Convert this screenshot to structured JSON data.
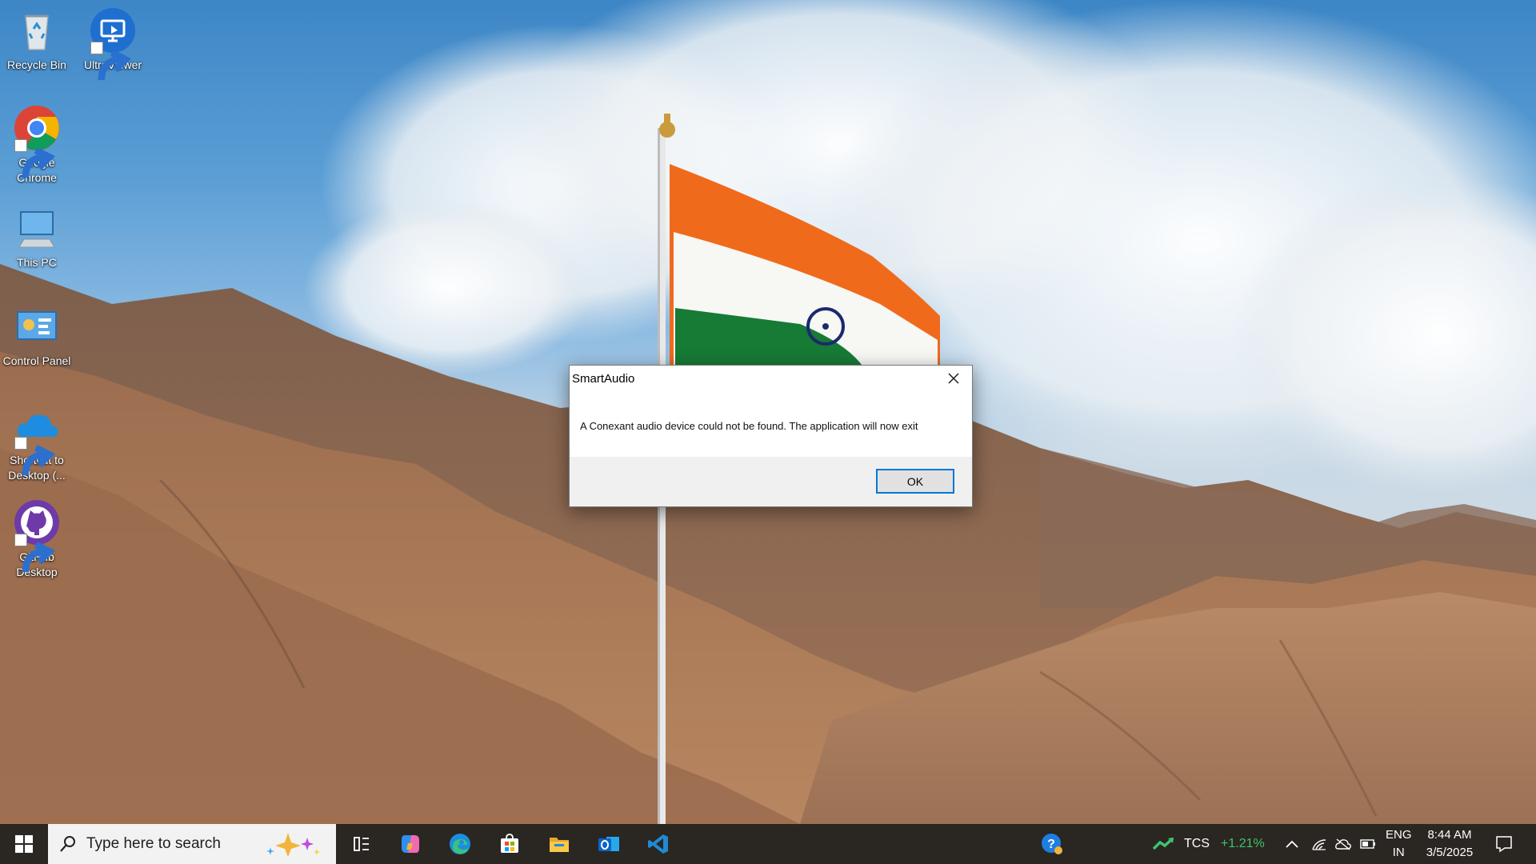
{
  "desktop": {
    "icons": [
      {
        "label": "Recycle Bin",
        "icon": "recycle-bin-icon"
      },
      {
        "label": "UltraViewer",
        "icon": "ultraviewer-icon"
      },
      {
        "label": "Google Chrome",
        "icon": "chrome-icon"
      },
      {
        "label": "This PC",
        "icon": "this-pc-icon"
      },
      {
        "label": "Control Panel",
        "icon": "control-panel-icon"
      },
      {
        "label": "Shortcut to Desktop (...",
        "icon": "onedrive-icon"
      },
      {
        "label": "GitHub Desktop",
        "icon": "github-icon"
      }
    ]
  },
  "dialog": {
    "title": "SmartAudio",
    "message": "A Conexant audio device could not be found. The application will now exit",
    "ok_label": "OK"
  },
  "taskbar": {
    "search_placeholder": "Type here to search",
    "apps": [
      "task-view-icon",
      "copilot-icon",
      "edge-icon",
      "store-icon",
      "file-explorer-icon",
      "outlook-icon",
      "vscode-icon"
    ],
    "stock": {
      "ticker": "TCS",
      "change": "+1.21%",
      "color": "#3fc36b"
    },
    "language": {
      "line1": "ENG",
      "line2": "IN"
    },
    "clock": {
      "time": "8:44 AM",
      "date": "3/5/2025"
    }
  },
  "colors": {
    "accent": "#0078d7",
    "taskbar": "#2a2622"
  }
}
